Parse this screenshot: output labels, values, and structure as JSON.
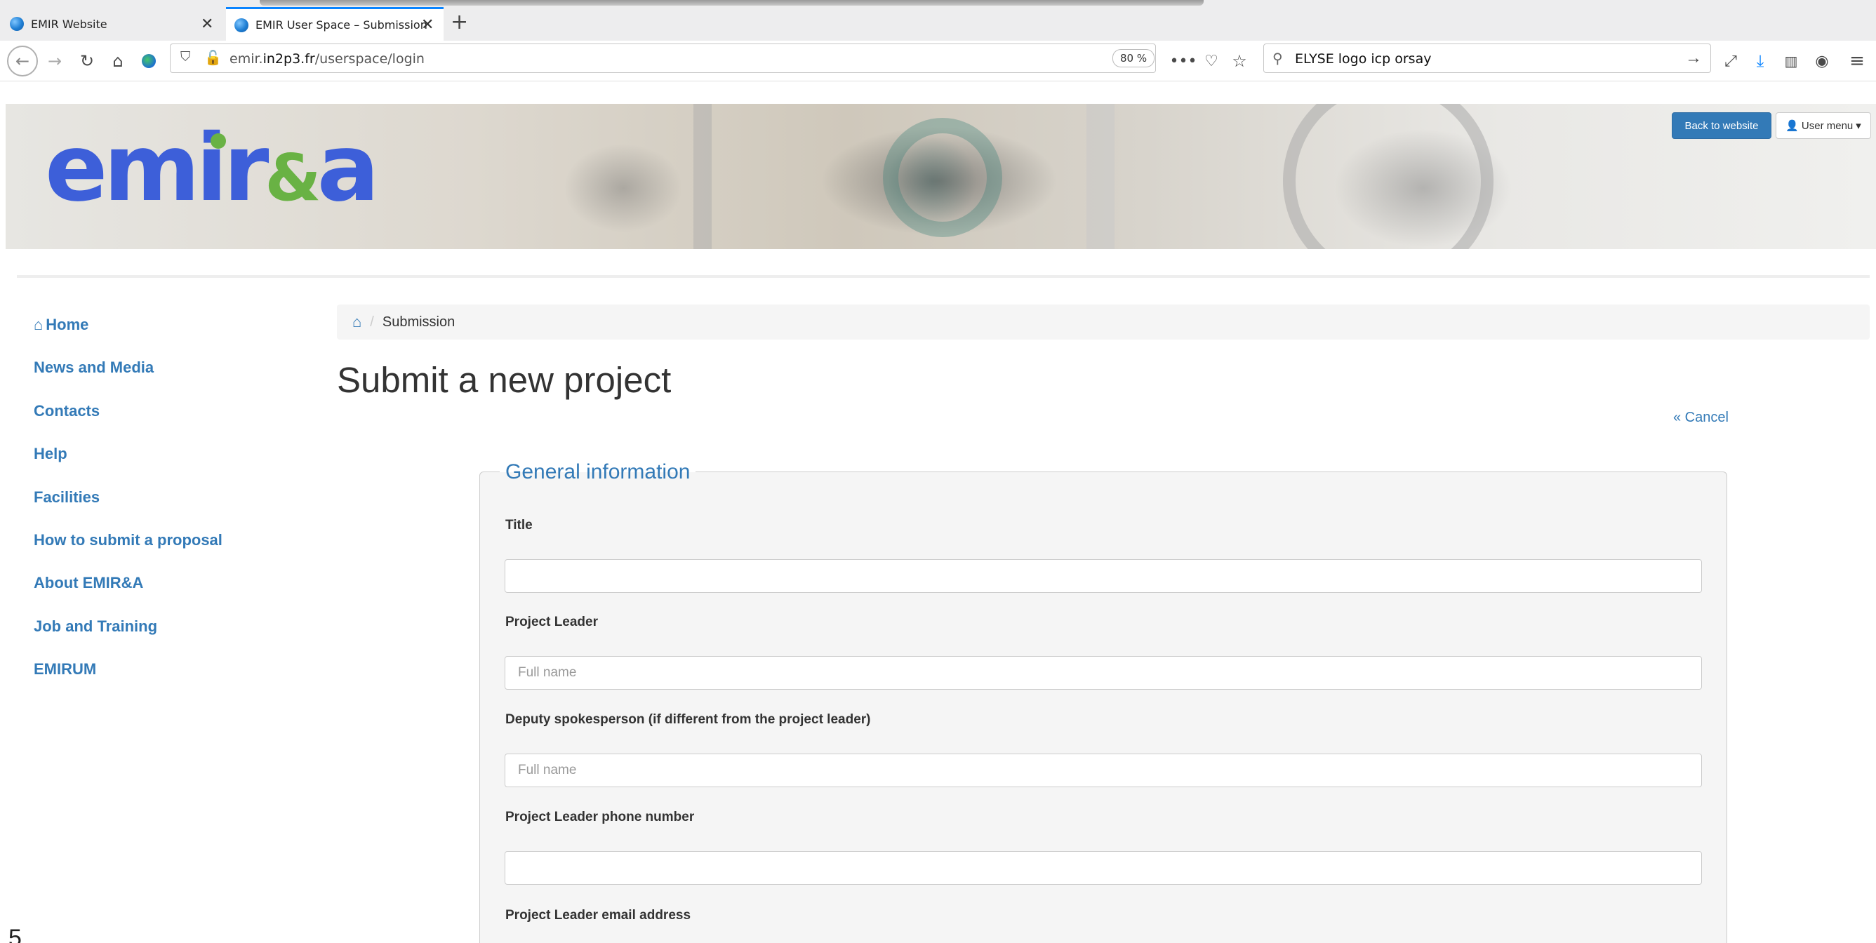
{
  "browser": {
    "tabs": [
      {
        "title": "EMIR Website",
        "active": false
      },
      {
        "title": "EMIR User Space – Submission",
        "active": true
      }
    ],
    "url_prefix": "emir.",
    "url_domain": "in2p3.fr",
    "url_path": "/userspace/login",
    "zoom": "80 %",
    "search_text": "ELYSE logo icp orsay"
  },
  "header": {
    "logo_main": "emir",
    "logo_amp": "&",
    "logo_end": "a",
    "back_to_website": "Back to website",
    "user_menu": "User menu"
  },
  "sidebar": {
    "items": [
      {
        "label": "Home"
      },
      {
        "label": "News and Media"
      },
      {
        "label": "Contacts"
      },
      {
        "label": "Help"
      },
      {
        "label": "Facilities"
      },
      {
        "label": "How to submit a proposal"
      },
      {
        "label": "About EMIR&A"
      },
      {
        "label": "Job and Training"
      },
      {
        "label": "EMIRUM"
      }
    ]
  },
  "main": {
    "breadcrumb_current": "Submission",
    "title": "Submit a new project",
    "cancel": "« Cancel",
    "section_title": "General information",
    "fields": [
      {
        "label": "Title",
        "placeholder": "",
        "value": ""
      },
      {
        "label": "Project Leader",
        "placeholder": "Full name",
        "value": ""
      },
      {
        "label": "Deputy spokesperson (if different from the project leader)",
        "placeholder": "Full name",
        "value": ""
      },
      {
        "label": "Project Leader phone number",
        "placeholder": "",
        "value": ""
      },
      {
        "label": "Project Leader email address"
      }
    ]
  },
  "page_number": "5",
  "colors": {
    "link": "#337ab7",
    "primary_button": "#337ab7",
    "logo_blue": "#3d5fd9",
    "logo_green": "#69b244"
  }
}
